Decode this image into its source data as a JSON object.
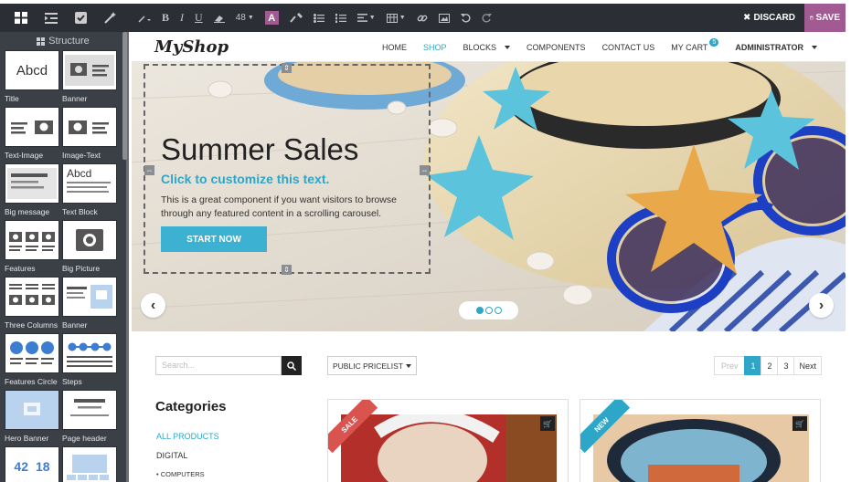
{
  "toolbar": {
    "discard_label": "DISCARD",
    "save_label": "SAVE",
    "font_size": "48",
    "text_color_letter": "A",
    "bold": "B",
    "italic": "I",
    "underline": "U"
  },
  "sidebar": {
    "title": "Structure",
    "snippets": [
      {
        "label": "Title",
        "thumb": "title"
      },
      {
        "label": "Banner",
        "thumb": "banner"
      },
      {
        "label": "Text-Image",
        "thumb": "text-image"
      },
      {
        "label": "Image-Text",
        "thumb": "image-text"
      },
      {
        "label": "Big message",
        "thumb": "big-message"
      },
      {
        "label": "Text Block",
        "thumb": "text-block"
      },
      {
        "label": "Features",
        "thumb": "features"
      },
      {
        "label": "Big Picture",
        "thumb": "big-picture"
      },
      {
        "label": "Three Columns",
        "thumb": "three-columns"
      },
      {
        "label": "Banner",
        "thumb": "banner2"
      },
      {
        "label": "Features Circle",
        "thumb": "features-circle"
      },
      {
        "label": "Steps",
        "thumb": "steps"
      },
      {
        "label": "Hero Banner",
        "thumb": "hero-banner"
      },
      {
        "label": "Page header",
        "thumb": "page-header"
      },
      {
        "label": "",
        "thumb": "numbers"
      },
      {
        "label": "",
        "thumb": "gallery"
      }
    ],
    "thumb_text": {
      "abcd": "Abcd",
      "n1": "42",
      "n2": "18"
    }
  },
  "site": {
    "logo": "MyShop",
    "menu": [
      {
        "label": "HOME",
        "active": false
      },
      {
        "label": "SHOP",
        "active": true
      },
      {
        "label": "BLOCKS",
        "active": false,
        "caret": true
      },
      {
        "label": "COMPONENTS",
        "active": false
      },
      {
        "label": "CONTACT US",
        "active": false
      },
      {
        "label": "MY CART",
        "active": false,
        "badge": "5"
      },
      {
        "label": "ADMINISTRATOR",
        "active": false,
        "caret": true,
        "bold": true
      }
    ],
    "hero": {
      "title": "Summer Sales",
      "subtitle": "Click to customize this text.",
      "body": "This is a great component if you want visitors to browse through any featured content in a scrolling carousel.",
      "cta": "START NOW",
      "prev": "‹",
      "next": "›",
      "slides": 3,
      "active_slide": 1
    },
    "shop": {
      "search_placeholder": "Search...",
      "pricelist": "PUBLIC PRICELIST",
      "pager": {
        "prev": "Prev",
        "pages": [
          "1",
          "2",
          "3"
        ],
        "current": "1",
        "next": "Next"
      },
      "categories_title": "Categories",
      "categories": [
        {
          "label": "ALL PRODUCTS",
          "active": true
        },
        {
          "label": "DIGITAL",
          "active": false
        },
        {
          "label": "• COMPUTERS",
          "active": false
        }
      ],
      "products": [
        {
          "ribbon": "SALE",
          "ribbon_color": "#d9534f"
        },
        {
          "ribbon": "NEW",
          "ribbon_color": "#2ea6c8"
        }
      ]
    }
  },
  "colors": {
    "accent": "#2ea6c8",
    "save": "#a15a92",
    "toolbar": "#2b2e35",
    "panel": "#3b3f46"
  }
}
